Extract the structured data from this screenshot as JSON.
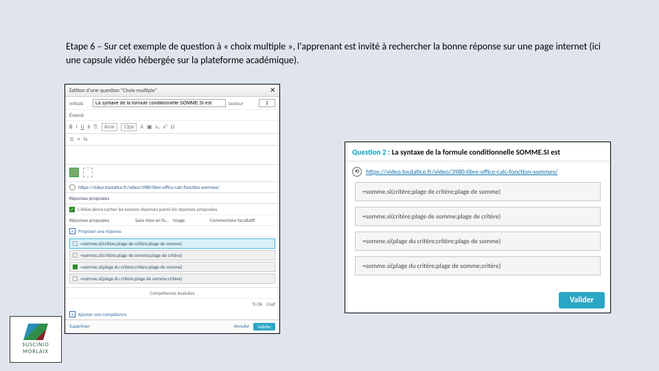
{
  "caption": "Etape 6 – Sur cet exemple de question à « choix multiple », l'apprenant est invité à rechercher la bonne réponse sur une page internet (ici une capsule vidéo hébergée sur la plateforme académique).",
  "editor": {
    "dialog_title": "Edition d'une question \"Choix multiple\"",
    "label_intitule": "Intitulé",
    "intitule_value": "La syntaxe de la formule conditionnelle SOMME.SI est",
    "label_secteur": "Secteur",
    "secteur_value": "1",
    "label_enonce": "Énoncé",
    "tb_bold": "B",
    "tb_italic": "I",
    "tb_underline": "U",
    "tb_strike": "S",
    "tb_font": "Arial",
    "tb_size": "13px",
    "tb_a": "A",
    "tb_omega": "Ω",
    "linked_url": "https://video.toutatice.fr/video/3980-libre-office-calc-fonction-sommes/",
    "sect_rep": "Réponses proposées",
    "info_text": "L'élève devra cocher les bonnes réponses parmi les réponses proposées",
    "rp_col1": "Réponses proposées",
    "rp_sans": "Sans mise en fo…",
    "rp_img": "Image",
    "rp_comm": "Commentaire facultatif",
    "add_resp": "Proposer une réponse",
    "resp1": "=somme.si(critère;plage de critère;plage de somme)",
    "resp2": "=somme.si(critère;plage de somme;plage de critère)",
    "resp3": "=somme.si(plage du critère;critère;plage de somme)",
    "resp4": "=somme.si(plage du critère;plage de somme;critère)",
    "sect_comp": "Compétences évaluées",
    "comp_score": "% Ok",
    "comp_coef": "Coef",
    "add_comp": "Ajouter une compétence",
    "btn_delete": "Supprimer",
    "btn_cancel": "Annuler",
    "btn_validate": "Valider"
  },
  "preview": {
    "q_label": "Question 2 :",
    "q_text": "La syntaxe de la formule conditionnelle SOMME.SI est",
    "link": "https://video.toutatice.fr/video/3980-libre-office-calc-fonction-sommes/",
    "opt1": "=somme.si(critère;plage de critère;plage de somme)",
    "opt2": "=somme.si(critère;plage de somme;plage de critère)",
    "opt3": "=somme.si(plage du critère;critère;plage de somme)",
    "opt4": "=somme.si(plage du critère;plage de somme;critère)",
    "btn_validate": "Valider"
  },
  "logo": {
    "line1": "SUSCINIO",
    "line2": "MORLAIX"
  }
}
